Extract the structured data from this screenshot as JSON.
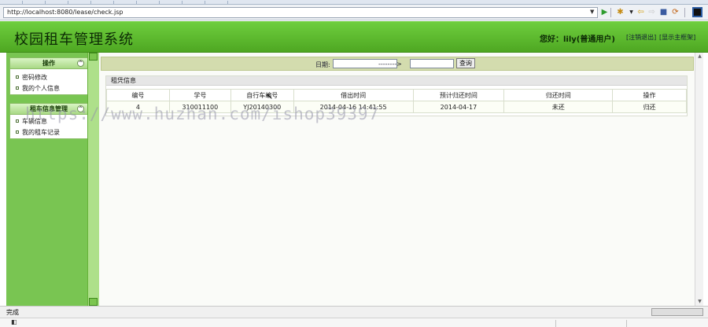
{
  "browser": {
    "url": "http://localhost:8080/lease/check.jsp",
    "status_text": "完成"
  },
  "header": {
    "title": "校园租车管理系统",
    "greeting_prefix": "您好：",
    "user": "lily(普通用户)",
    "logout": "[注销退出]",
    "show_main": "[显示主框架]"
  },
  "sidebar": {
    "sections": [
      {
        "title": "操作",
        "items": [
          {
            "label": "密码修改"
          },
          {
            "label": "我的个人信息"
          }
        ]
      },
      {
        "title": "租车信息管理",
        "items": [
          {
            "label": "车辆信息"
          },
          {
            "label": "我的租车记录"
          }
        ]
      }
    ]
  },
  "search": {
    "date_label": "日期:",
    "separator": "-------->",
    "button": "查询"
  },
  "records": {
    "caption": "租凭信息",
    "columns": [
      "编号",
      "学号",
      "自行车编号",
      "借出时间",
      "预计归还时间",
      "归还时间",
      "操作"
    ],
    "rows": [
      {
        "id": "4",
        "student_no": "310011100",
        "bike_no": "YJ20140300",
        "lend_time": "2014-04-16 14:41:55",
        "due": "2014-04-17",
        "returned": "未还",
        "action": "归还"
      }
    ]
  },
  "watermark": "https://www.huzhan.com/ishop39397"
}
